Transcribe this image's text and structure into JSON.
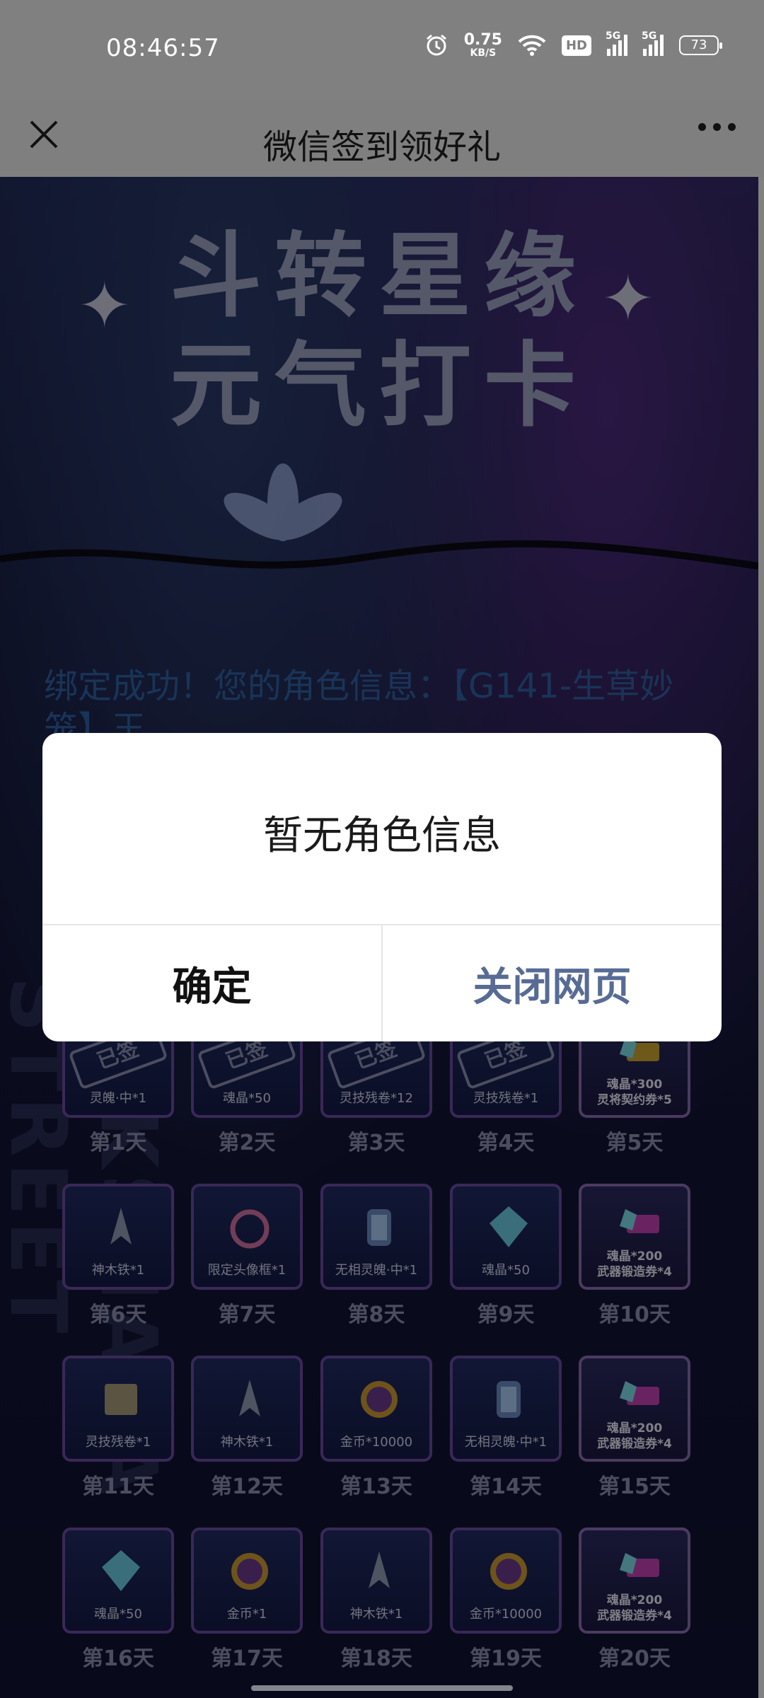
{
  "status_bar": {
    "time": "08:46:57",
    "net_speed_value": "0.75",
    "net_speed_unit": "KB/S",
    "hd_label": "HD",
    "sim1_label": "5G",
    "sim2_label": "5G",
    "battery": "73"
  },
  "header": {
    "title": "微信签到领好礼"
  },
  "banner": {
    "title_line1": "斗转星缘",
    "title_line2": "元气打卡"
  },
  "bind_message": "绑定成功！您的角色信息：【G141-生草妙笼】王",
  "side_text": "RAKSHASA STREET",
  "signed_label": "已签",
  "days": [
    {
      "day": "第1天",
      "reward": "灵魄·中*1",
      "signed": true
    },
    {
      "day": "第2天",
      "reward": "魂晶*50",
      "signed": true
    },
    {
      "day": "第3天",
      "reward": "灵技残卷*12",
      "signed": true
    },
    {
      "day": "第4天",
      "reward": "灵技残卷*1",
      "signed": true
    },
    {
      "day": "第5天",
      "reward_line1": "魂晶*300",
      "reward_line2": "灵将契约券*5",
      "signed": false
    },
    {
      "day": "第6天",
      "reward": "神木铁*1"
    },
    {
      "day": "第7天",
      "reward": "限定头像框*1"
    },
    {
      "day": "第8天",
      "reward": "无相灵魄·中*1"
    },
    {
      "day": "第9天",
      "reward": "魂晶*50"
    },
    {
      "day": "第10天",
      "reward_line1": "魂晶*200",
      "reward_line2": "武器锻造券*4"
    },
    {
      "day": "第11天",
      "reward": "灵技残卷*1"
    },
    {
      "day": "第12天",
      "reward": "神木铁*1"
    },
    {
      "day": "第13天",
      "reward": "金币*10000"
    },
    {
      "day": "第14天",
      "reward": "无相灵魄·中*1"
    },
    {
      "day": "第15天",
      "reward_line1": "魂晶*200",
      "reward_line2": "武器锻造券*4"
    },
    {
      "day": "第16天",
      "reward": "魂晶*50"
    },
    {
      "day": "第17天",
      "reward": "金币*1"
    },
    {
      "day": "第18天",
      "reward": "神木铁*1"
    },
    {
      "day": "第19天",
      "reward": "金币*10000"
    },
    {
      "day": "第20天",
      "reward_line1": "魂晶*200",
      "reward_line2": "武器锻造券*4"
    }
  ],
  "dialog": {
    "message": "暂无角色信息",
    "confirm_label": "确定",
    "close_label": "关闭网页"
  },
  "colors": {
    "dialog_link": "#576b95",
    "bind_text": "#2f5fa0",
    "card_border": "#6a4aa0"
  }
}
